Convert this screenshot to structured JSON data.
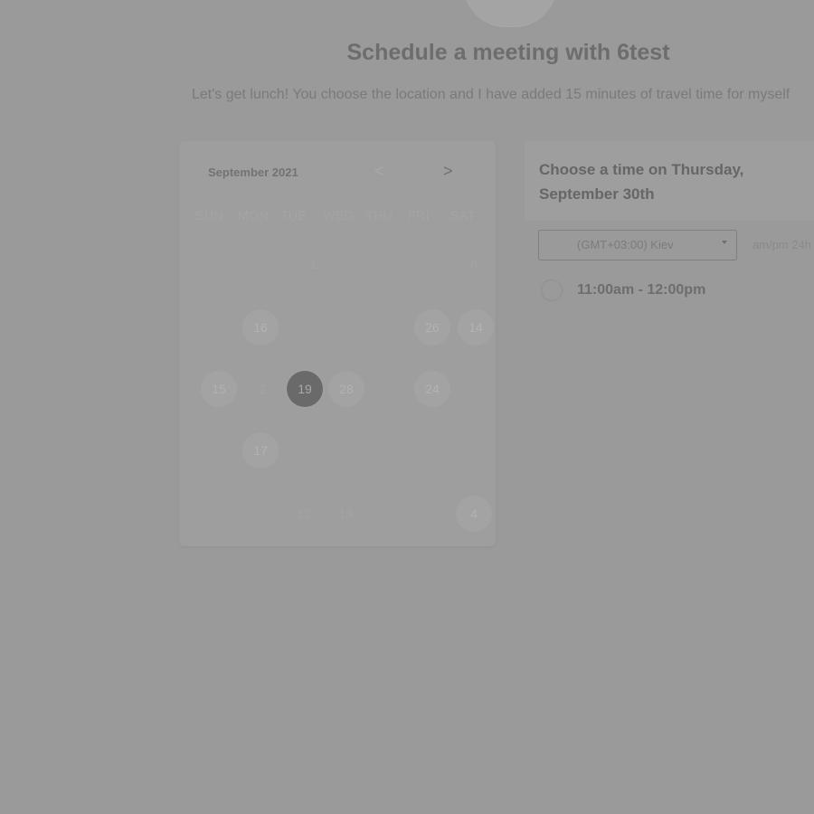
{
  "header": {
    "title": "Schedule a meeting with 6test",
    "subtitle": "Let's get lunch! You choose the location and I have added 15 minutes of travel time for myself"
  },
  "calendar": {
    "month_label": "September 2021",
    "prev_icon": "chevron-left-icon",
    "next_icon": "chevron-right-icon",
    "next_label": ">",
    "prev_label": "<",
    "weekdays": [
      "SUN",
      "MON",
      "TUE",
      "WED",
      "THU",
      "FRI",
      "SAT"
    ],
    "days": [
      {
        "label": "1",
        "state": "plain"
      },
      {
        "label": "6",
        "state": "plain"
      },
      {
        "label": "16",
        "state": "available"
      },
      {
        "label": "26",
        "state": "available"
      },
      {
        "label": "14",
        "state": "available"
      },
      {
        "label": "15",
        "state": "available"
      },
      {
        "label": "2",
        "state": "plain"
      },
      {
        "label": "19",
        "state": "selected"
      },
      {
        "label": "28",
        "state": "available"
      },
      {
        "label": "24",
        "state": "available"
      },
      {
        "label": "17",
        "state": "available"
      },
      {
        "label": "12",
        "state": "plain"
      },
      {
        "label": "13",
        "state": "plain"
      },
      {
        "label": "4",
        "state": "available"
      }
    ]
  },
  "times": {
    "title": "Choose a time on Thursday, September 30th",
    "timezone": "(GMT+03:00) Kiev",
    "format_toggle": "am/pm  24h",
    "slots": [
      {
        "label": "11:00am - 12:00pm"
      }
    ]
  },
  "colors": {
    "overlay": "#9a9a9a",
    "selected_day": "#6a6a6a"
  }
}
